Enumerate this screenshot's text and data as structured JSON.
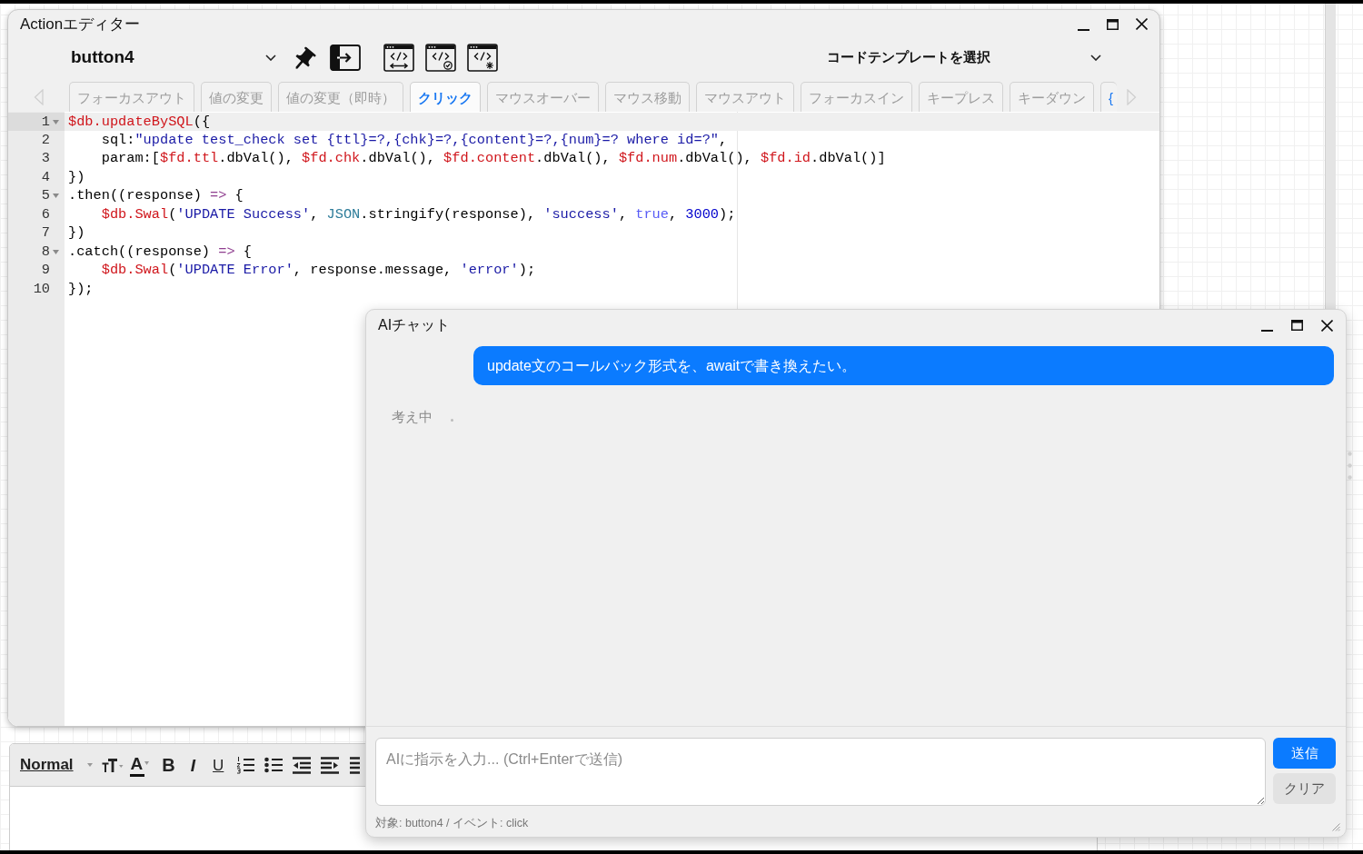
{
  "action_editor": {
    "title": "Actionエディター",
    "target_select": {
      "value": "button4"
    },
    "template_select": {
      "value": "コードテンプレートを選択"
    },
    "event_tabs": [
      {
        "label": "フォーカスアウト",
        "selected": false,
        "kind": "event"
      },
      {
        "label": "値の変更",
        "selected": false,
        "kind": "event"
      },
      {
        "label": "値の変更（即時）",
        "selected": false,
        "kind": "event"
      },
      {
        "label": "クリック",
        "selected": true,
        "kind": "event"
      },
      {
        "label": "マウスオーバー",
        "selected": false,
        "kind": "event"
      },
      {
        "label": "マウス移動",
        "selected": false,
        "kind": "event"
      },
      {
        "label": "マウスアウト",
        "selected": false,
        "kind": "event"
      },
      {
        "label": "フォーカスイン",
        "selected": false,
        "kind": "event"
      },
      {
        "label": "キープレス",
        "selected": false,
        "kind": "event"
      },
      {
        "label": "キーダウン",
        "selected": false,
        "kind": "event"
      },
      {
        "label": "{",
        "selected": false,
        "kind": "code"
      }
    ],
    "code_lines": [
      {
        "number": "1",
        "foldable": true,
        "active": true,
        "tokens": [
          {
            "text": "$db.updateBySQL",
            "kind": "variable"
          },
          {
            "text": "({",
            "kind": "plain"
          }
        ]
      },
      {
        "number": "2",
        "foldable": false,
        "active": false,
        "tokens": [
          {
            "text": "    sql:",
            "kind": "plain"
          },
          {
            "text": "\"update test_check set {ttl}=?,{chk}=?,{content}=?,{num}=? where id=?\"",
            "kind": "string"
          },
          {
            "text": ",",
            "kind": "plain"
          }
        ]
      },
      {
        "number": "3",
        "foldable": false,
        "active": false,
        "tokens": [
          {
            "text": "    param:[",
            "kind": "plain"
          },
          {
            "text": "$fd.ttl",
            "kind": "variable"
          },
          {
            "text": ".dbVal(), ",
            "kind": "plain"
          },
          {
            "text": "$fd.chk",
            "kind": "variable"
          },
          {
            "text": ".dbVal(), ",
            "kind": "plain"
          },
          {
            "text": "$fd.content",
            "kind": "variable"
          },
          {
            "text": ".dbVal(), ",
            "kind": "plain"
          },
          {
            "text": "$fd.num",
            "kind": "variable"
          },
          {
            "text": ".dbVal(), ",
            "kind": "plain"
          },
          {
            "text": "$fd.id",
            "kind": "variable"
          },
          {
            "text": ".dbVal()]",
            "kind": "plain"
          }
        ]
      },
      {
        "number": "4",
        "foldable": false,
        "active": false,
        "tokens": [
          {
            "text": "})",
            "kind": "plain"
          }
        ]
      },
      {
        "number": "5",
        "foldable": true,
        "active": false,
        "tokens": [
          {
            "text": ".then((response) ",
            "kind": "plain"
          },
          {
            "text": "=>",
            "kind": "operator"
          },
          {
            "text": " {",
            "kind": "plain"
          }
        ]
      },
      {
        "number": "6",
        "foldable": false,
        "active": false,
        "tokens": [
          {
            "text": "    $db.Swal",
            "kind": "variable"
          },
          {
            "text": "(",
            "kind": "plain"
          },
          {
            "text": "'UPDATE Success'",
            "kind": "string"
          },
          {
            "text": ", ",
            "kind": "plain"
          },
          {
            "text": "JSON",
            "kind": "support"
          },
          {
            "text": ".stringify(response), ",
            "kind": "plain"
          },
          {
            "text": "'success'",
            "kind": "string"
          },
          {
            "text": ", ",
            "kind": "plain"
          },
          {
            "text": "true",
            "kind": "constant"
          },
          {
            "text": ", ",
            "kind": "plain"
          },
          {
            "text": "3000",
            "kind": "number"
          },
          {
            "text": ");",
            "kind": "plain"
          }
        ]
      },
      {
        "number": "7",
        "foldable": false,
        "active": false,
        "tokens": [
          {
            "text": "})",
            "kind": "plain"
          }
        ]
      },
      {
        "number": "8",
        "foldable": true,
        "active": false,
        "tokens": [
          {
            "text": ".catch((response) ",
            "kind": "plain"
          },
          {
            "text": "=>",
            "kind": "operator"
          },
          {
            "text": " {",
            "kind": "plain"
          }
        ]
      },
      {
        "number": "9",
        "foldable": false,
        "active": false,
        "tokens": [
          {
            "text": "    $db.Swal",
            "kind": "variable"
          },
          {
            "text": "(",
            "kind": "plain"
          },
          {
            "text": "'UPDATE Error'",
            "kind": "string"
          },
          {
            "text": ", response.message, ",
            "kind": "plain"
          },
          {
            "text": "'error'",
            "kind": "string"
          },
          {
            "text": ");",
            "kind": "plain"
          }
        ]
      },
      {
        "number": "10",
        "foldable": false,
        "active": false,
        "tokens": [
          {
            "text": "});",
            "kind": "plain"
          }
        ]
      }
    ]
  },
  "rich_text_editor": {
    "toolbar": {
      "format": "Normal",
      "color_label": "A",
      "style_buttons": [
        {
          "kind": "bold",
          "label": "B"
        },
        {
          "kind": "italic",
          "label": "I"
        },
        {
          "kind": "underline",
          "label": "U"
        }
      ]
    }
  },
  "ai_chat": {
    "title": "AIチャット",
    "messages": [
      {
        "kind": "user",
        "text": "update文のコールバック形式を、awaitで書き換えたい。"
      },
      {
        "kind": "status",
        "text": "考え中"
      }
    ],
    "input": {
      "placeholder": "AIに指示を入力... (Ctrl+Enterで送信)"
    },
    "buttons": [
      {
        "kind": "primary",
        "label": "送信"
      },
      {
        "kind": "secondary",
        "label": "クリア"
      }
    ],
    "context": "対象: button4 / イベント: click"
  }
}
